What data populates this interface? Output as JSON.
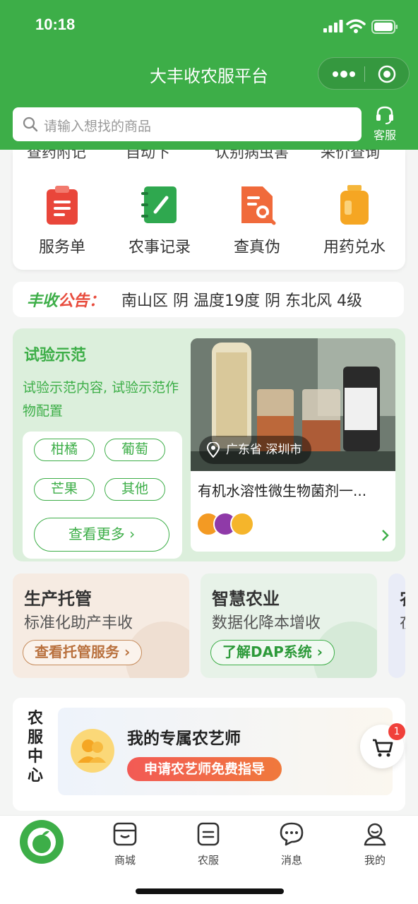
{
  "status": {
    "time": "10:18"
  },
  "nav": {
    "title": "大丰收农服平台"
  },
  "search": {
    "placeholder": "请输入想找的商品"
  },
  "customer_service": {
    "label": "客服"
  },
  "services": {
    "cut_row": [
      "查药附记",
      "自动下",
      "认别病虫害",
      "采价查询"
    ],
    "items": [
      {
        "label": "服务单",
        "icon": "clipboard-icon",
        "color": "#e9463a"
      },
      {
        "label": "农事记录",
        "icon": "notebook-icon",
        "color": "#2fa84f"
      },
      {
        "label": "查真伪",
        "icon": "document-search-icon",
        "color": "#f06a3b"
      },
      {
        "label": "用药兑水",
        "icon": "bottle-icon",
        "color": "#f5a623"
      }
    ]
  },
  "notice": {
    "tag_a": "丰收",
    "tag_b": "公告",
    "colon": "：",
    "text": "南山区 阴 温度19度 阴 东北风 4级"
  },
  "demo": {
    "title": "试验示范",
    "desc": "试验示范内容, 试验示范作物配置",
    "chips": [
      "柑橘",
      "葡萄",
      "芒果",
      "其他"
    ],
    "more": "查看更多",
    "product": {
      "location": "广东省  深圳市",
      "name": "有机水溶性微生物菌剂一..."
    }
  },
  "promos": [
    {
      "title": "生产托管",
      "subtitle": "标准化助产丰收",
      "button": "查看托管服务"
    },
    {
      "title": "智慧农业",
      "subtitle": "数据化降本增收",
      "button": "了解DAP系统"
    },
    {
      "title": "农",
      "subtitle": "在",
      "button": ""
    }
  ],
  "agro": {
    "vertical": [
      "农",
      "服",
      "中",
      "心"
    ],
    "title": "我的专属农艺师",
    "button": "申请农艺师免费指导"
  },
  "cart": {
    "badge": "1"
  },
  "tabs": [
    {
      "label": "商城",
      "icon": "shop-icon"
    },
    {
      "label": "农服",
      "icon": "service-icon"
    },
    {
      "label": "消息",
      "icon": "message-icon"
    },
    {
      "label": "我的",
      "icon": "profile-icon"
    }
  ]
}
